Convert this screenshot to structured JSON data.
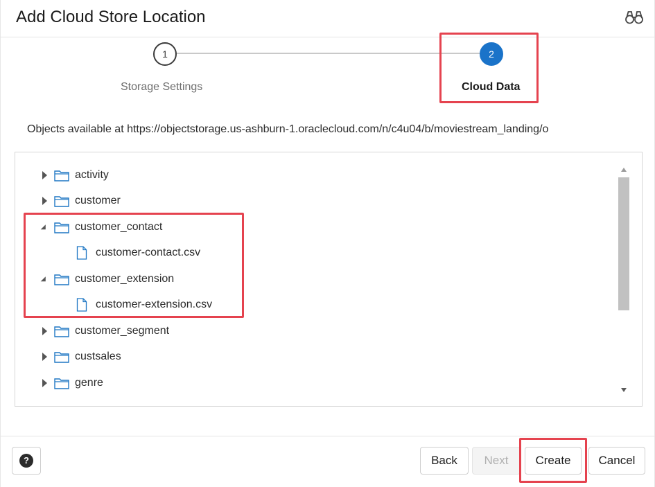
{
  "dialog": {
    "title": "Add Cloud Store Location",
    "header_icon": "binoculars-icon"
  },
  "stepper": {
    "steps": [
      {
        "number": "1",
        "label": "Storage Settings",
        "state": "completed"
      },
      {
        "number": "2",
        "label": "Cloud Data",
        "state": "active"
      }
    ]
  },
  "objects_text": "Objects available at https://objectstorage.us-ashburn-1.oraclecloud.com/n/c4u04/b/moviestream_landing/o",
  "tree": {
    "items": [
      {
        "type": "folder",
        "label": "activity",
        "expanded": false,
        "level": 0
      },
      {
        "type": "folder",
        "label": "customer",
        "expanded": false,
        "level": 0
      },
      {
        "type": "folder",
        "label": "customer_contact",
        "expanded": true,
        "level": 0
      },
      {
        "type": "file",
        "label": "customer-contact.csv",
        "level": 1
      },
      {
        "type": "folder",
        "label": "customer_extension",
        "expanded": true,
        "level": 0
      },
      {
        "type": "file",
        "label": "customer-extension.csv",
        "level": 1
      },
      {
        "type": "folder",
        "label": "customer_segment",
        "expanded": false,
        "level": 0
      },
      {
        "type": "folder",
        "label": "custsales",
        "expanded": false,
        "level": 0
      },
      {
        "type": "folder",
        "label": "genre",
        "expanded": false,
        "level": 0
      }
    ]
  },
  "footer": {
    "help_label": "?",
    "back_label": "Back",
    "next_label": "Next",
    "create_label": "Create",
    "cancel_label": "Cancel"
  },
  "colors": {
    "accent": "#1a73c9",
    "annotation": "#e5434f"
  }
}
